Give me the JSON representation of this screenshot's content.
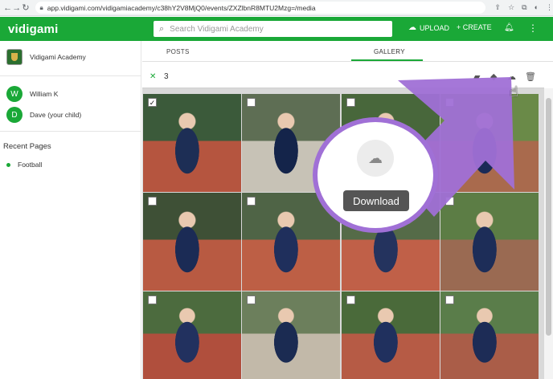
{
  "browser": {
    "url": "app.vidigami.com/vidigamiacademy/c38hY2V8MjQ0/events/ZXZlbnR8MTU2Mzg=/media",
    "nav_icons": [
      "back-arrow-icon",
      "forward-arrow-icon",
      "reload-icon"
    ],
    "tool_icons": [
      "share-icon",
      "bookmark-star-icon",
      "extensions-icon",
      "profile-icon",
      "menu-icon"
    ]
  },
  "header": {
    "logo": "vidigami",
    "search_placeholder": "Search Vidigami Academy",
    "upload_label": "UPLOAD",
    "create_label": "+ CREATE",
    "accent_color": "#1aa837"
  },
  "sidebar": {
    "org_name": "Vidigami Academy",
    "people": [
      {
        "initial": "W",
        "name": "William K"
      },
      {
        "initial": "D",
        "name": "Dave (your child)"
      }
    ],
    "recent_title": "Recent Pages",
    "recent_items": [
      "Football"
    ]
  },
  "tabs": [
    {
      "label": "POSTS",
      "active": false
    },
    {
      "label": "GALLERY",
      "active": true
    }
  ],
  "selection": {
    "count": "3",
    "actions": [
      "folder-icon",
      "tag-icon",
      "download-icon",
      "trash-icon"
    ]
  },
  "photos": [
    {
      "checked": true
    },
    {
      "checked": false
    },
    {
      "checked": false
    },
    {
      "checked": false
    },
    {
      "checked": false
    },
    {
      "checked": false
    },
    {
      "checked": false
    },
    {
      "checked": false
    },
    {
      "checked": false
    },
    {
      "checked": false
    },
    {
      "checked": false
    },
    {
      "checked": false
    }
  ],
  "highlight": {
    "tooltip": "Download",
    "ring_color": "#a070d6"
  }
}
